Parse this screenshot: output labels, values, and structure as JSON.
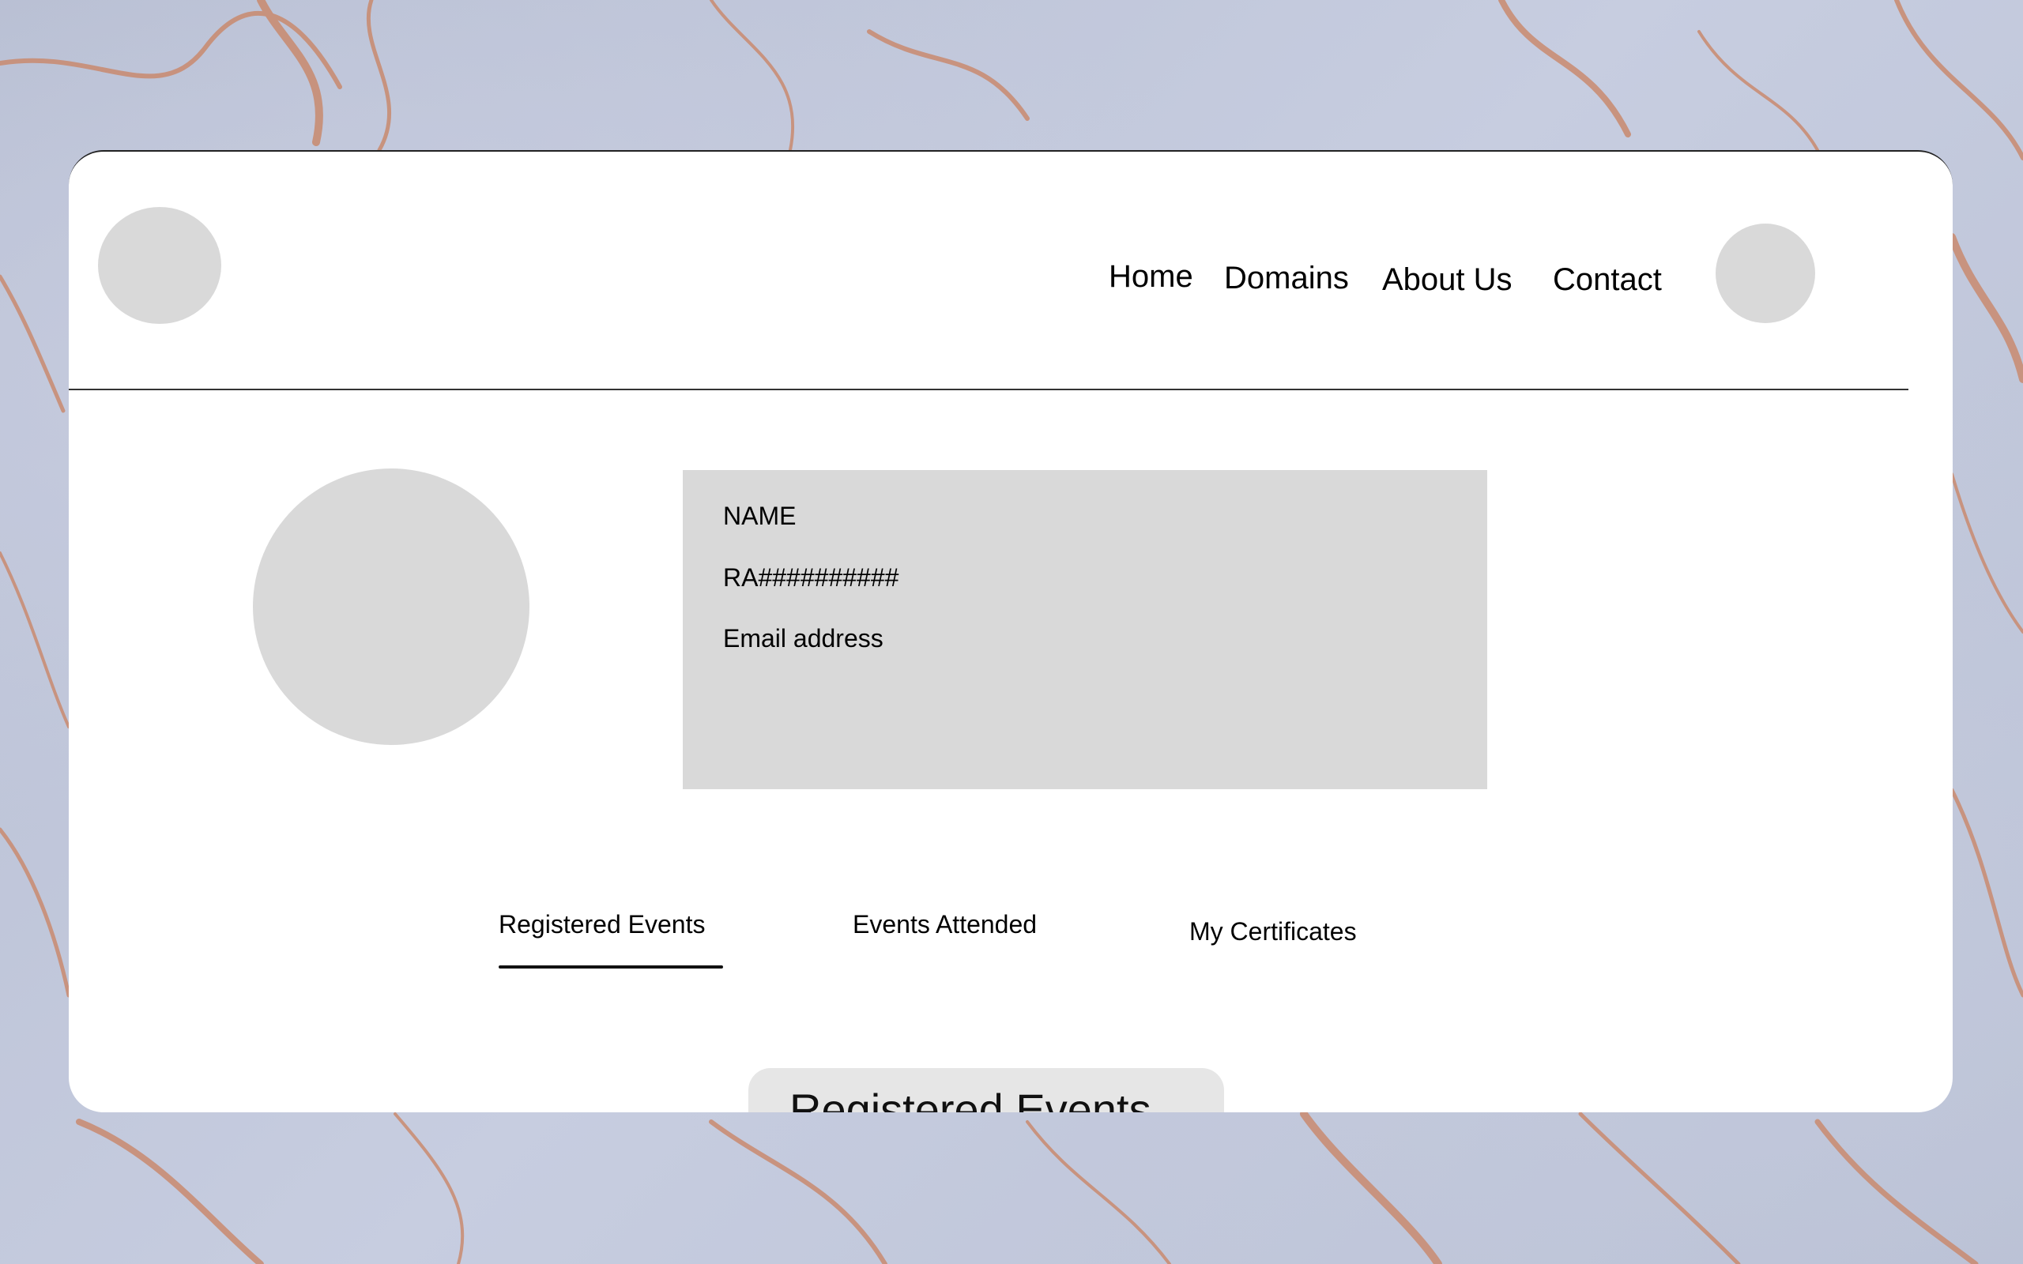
{
  "nav": {
    "items": [
      "Home",
      "Domains",
      "About Us",
      "Contact"
    ]
  },
  "profile": {
    "name": "NAME",
    "reg_no": "RA##########",
    "email": "Email address"
  },
  "tabs": {
    "items": [
      "Registered Events",
      "Events Attended",
      "My Certificates"
    ],
    "active": "Registered Events"
  },
  "section": {
    "title": "Registered Events"
  },
  "colors": {
    "placeholder_gray": "#d9d9d9",
    "card_bg": "#ffffff",
    "text": "#000000",
    "marble_base": "#bcc3d6",
    "marble_vein": "#c98a6e"
  }
}
